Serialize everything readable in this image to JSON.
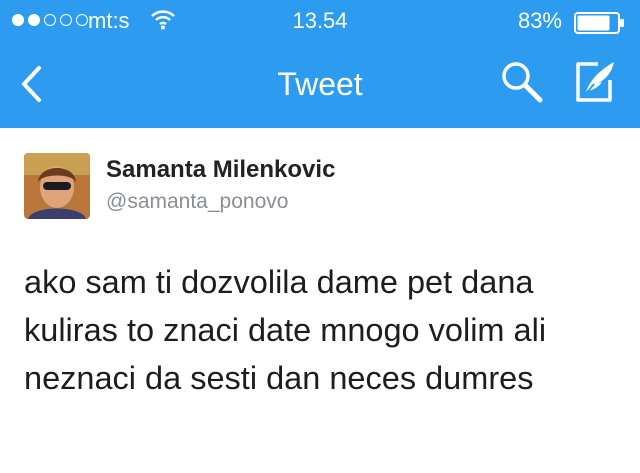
{
  "status_bar": {
    "carrier": "mt:s",
    "time": "13.54",
    "battery_percent": "83%",
    "battery_level": 0.83,
    "signal_bars_filled": 2,
    "signal_bars_total": 5
  },
  "nav": {
    "title": "Tweet",
    "back_icon": "chevron-left-icon",
    "search_icon": "search-icon",
    "compose_icon": "compose-icon"
  },
  "tweet": {
    "author_name": "Samanta Milenkovic",
    "author_handle": "@samanta_ponovo",
    "text": "ako sam ti dozvolila dame pet dana kuliras to znaci date mnogo volim ali neznaci da sesti dan neces dumres"
  },
  "colors": {
    "header_bg": "#2d9cf0",
    "header_fg": "#ffffff",
    "handle": "#8a8f96"
  }
}
